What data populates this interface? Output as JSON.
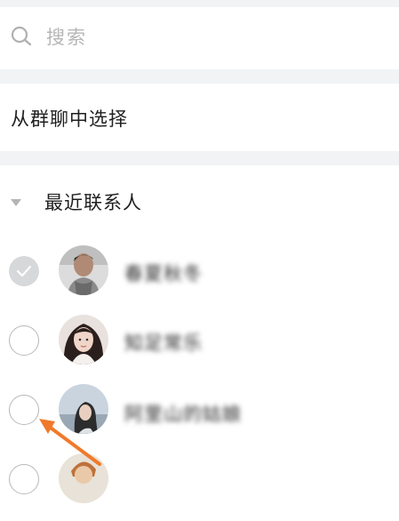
{
  "search": {
    "placeholder": "搜索"
  },
  "group_select": {
    "label": "从群聊中选择"
  },
  "recent_section": {
    "label": "最近联系人"
  },
  "contacts": [
    {
      "name": "春夏秋冬",
      "checked": true
    },
    {
      "name": "知足常乐",
      "checked": false
    },
    {
      "name": "阿里山的姑娘",
      "checked": false
    },
    {
      "name": "",
      "checked": false
    }
  ],
  "colors": {
    "arrow": "#f07a2a",
    "divider": "#f2f3f5",
    "check_fill": "#d7d8da"
  }
}
